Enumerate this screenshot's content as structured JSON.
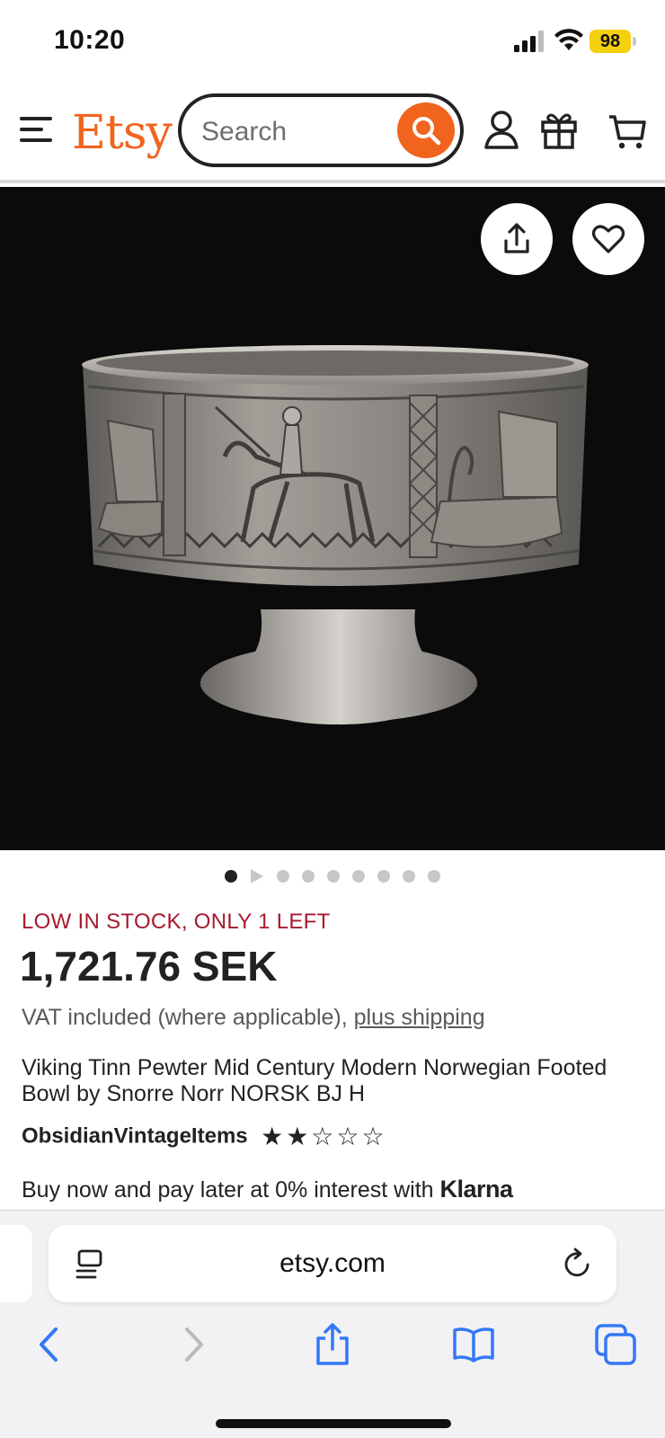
{
  "status_bar": {
    "time": "10:20",
    "battery": "98"
  },
  "header": {
    "logo": "Etsy",
    "search_placeholder": "Search"
  },
  "listing": {
    "image_alt": "Pewter footed bowl with Viking ship and horseman relief",
    "image_count": 9,
    "active_image": 1,
    "stock_notice": "LOW IN STOCK, ONLY 1 LEFT",
    "price": "1,721.76 SEK",
    "vat_text": "VAT included (where applicable), ",
    "shipping_link": "plus shipping",
    "title": "Viking Tinn Pewter Mid Century Modern Norwegian Footed Bowl by Snorre Norr NORSK BJ H",
    "shop_name": "ObsidianVintageItems",
    "rating": 2,
    "rating_max": 5,
    "klarna_text": "Buy now and pay later at 0% interest with ",
    "klarna_brand": "Klarna"
  },
  "safari": {
    "url": "etsy.com"
  },
  "colors": {
    "brand": "#f1641e",
    "stock_red": "#a61a2e",
    "safari_blue": "#3478f6"
  }
}
